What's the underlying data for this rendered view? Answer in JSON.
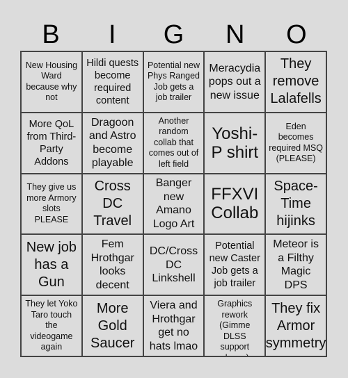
{
  "header": [
    "B",
    "I",
    "G",
    "N",
    "O"
  ],
  "cells": [
    {
      "text": "New Housing Ward because why not",
      "size": "s11"
    },
    {
      "text": "Hildi quests become required content",
      "size": "s13"
    },
    {
      "text": "Potential new Phys Ranged Job gets a job trailer",
      "size": "s11"
    },
    {
      "text": "Meracydia pops out a new issue",
      "size": "s15"
    },
    {
      "text": "They remove Lalafells",
      "size": "s20"
    },
    {
      "text": "More QoL from Third-Party Addons",
      "size": "s13"
    },
    {
      "text": "Dragoon and Astro become playable",
      "size": "s15"
    },
    {
      "text": "Another random collab that comes out of left field",
      "size": "s11"
    },
    {
      "text": "Yoshi-P shirt",
      "size": "s24"
    },
    {
      "text": "Eden becomes required MSQ (PLEASE)",
      "size": "s11"
    },
    {
      "text": "They give us more Armory slots PLEASE",
      "size": "s11"
    },
    {
      "text": "Cross DC Travel",
      "size": "s20"
    },
    {
      "text": "Banger new Amano Logo Art",
      "size": "s15"
    },
    {
      "text": "FFXVI Collab",
      "size": "s24"
    },
    {
      "text": "Space-Time hijinks",
      "size": "s20"
    },
    {
      "text": "New job has a Gun",
      "size": "s20"
    },
    {
      "text": "Fem Hrothgar looks decent",
      "size": "s15"
    },
    {
      "text": "DC/Cross DC Linkshell",
      "size": "s15"
    },
    {
      "text": "Potential new Caster Job gets a job trailer",
      "size": "s13"
    },
    {
      "text": "Meteor is a Filthy Magic DPS",
      "size": "s15"
    },
    {
      "text": "They let Yoko Taro touch the videogame again",
      "size": "s11"
    },
    {
      "text": "More Gold Saucer",
      "size": "s20"
    },
    {
      "text": "Viera and Hrothgar get no hats lmao",
      "size": "s15"
    },
    {
      "text": "Info on Graphics rework (Gimme DLSS support please)",
      "size": "s11"
    },
    {
      "text": "They fix Armor symmetry",
      "size": "s20"
    }
  ]
}
